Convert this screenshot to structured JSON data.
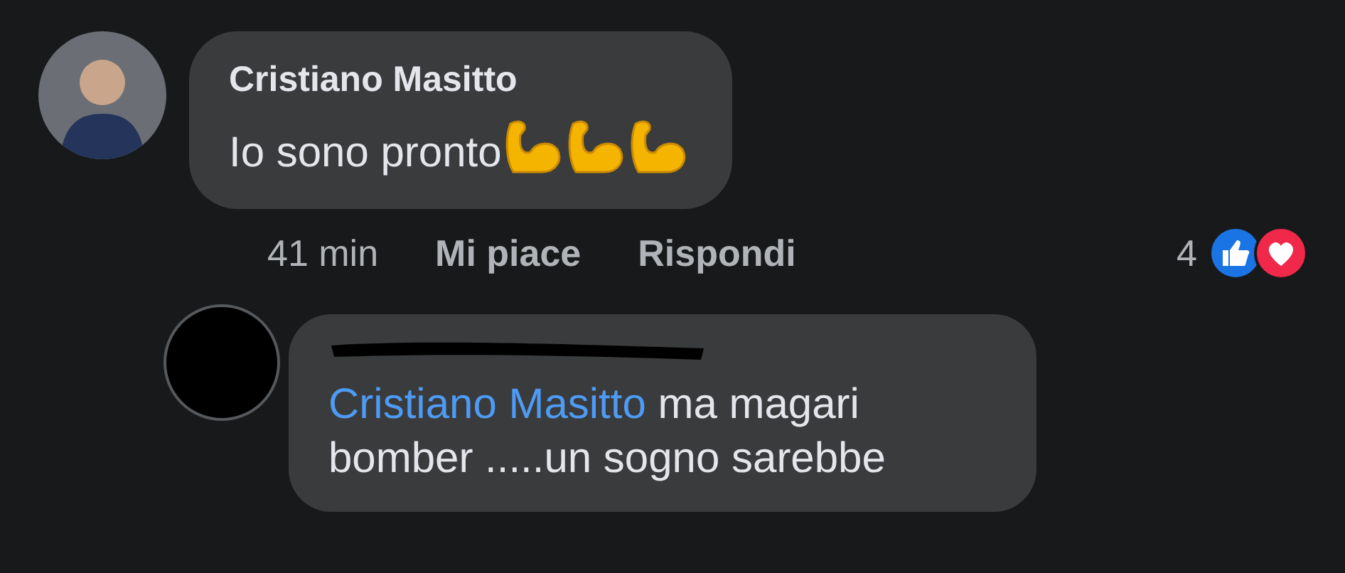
{
  "comment": {
    "author": "Cristiano Masitto",
    "text": "Io sono pronto",
    "emojis": [
      {
        "kind": "flexed-biceps"
      },
      {
        "kind": "flexed-biceps"
      },
      {
        "kind": "flexed-biceps"
      }
    ],
    "time": "41 min",
    "actions": [
      "Mi piace",
      "Rispondi"
    ],
    "reaction_count": "4",
    "reactions": [
      {
        "kind": "like"
      },
      {
        "kind": "love"
      }
    ]
  },
  "reply": {
    "author_redacted": true,
    "mention": "Cristiano Masitto",
    "text": "ma magari bomber .....un sogno sarebbe"
  }
}
